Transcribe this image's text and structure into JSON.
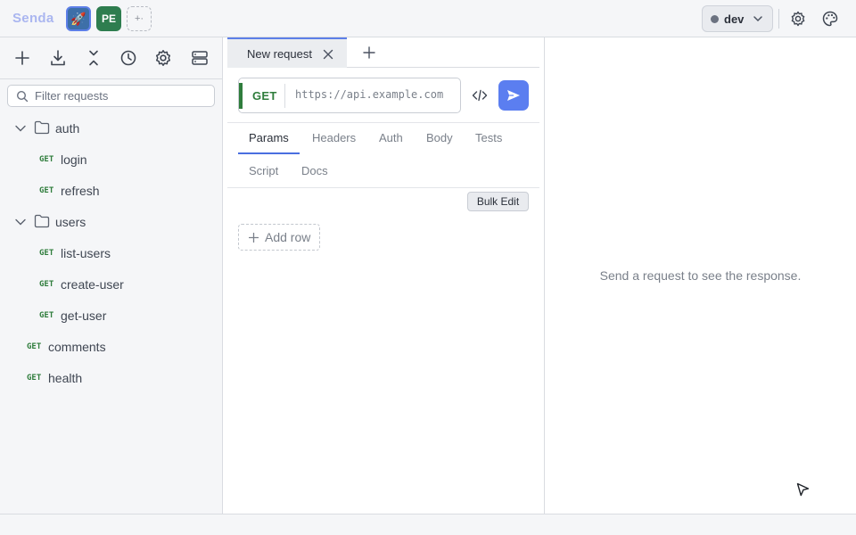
{
  "app": {
    "brand": "Senda"
  },
  "workspaces": [
    {
      "label": "🚀",
      "icon": "rocket-icon"
    },
    {
      "label": "PE"
    },
    {
      "label": "+·"
    }
  ],
  "environment": {
    "label": "dev"
  },
  "sidebar": {
    "filter_placeholder": "Filter requests",
    "tree": [
      {
        "type": "folder",
        "label": "auth",
        "expanded": true
      },
      {
        "type": "request",
        "method": "GET",
        "label": "login"
      },
      {
        "type": "request",
        "method": "GET",
        "label": "refresh"
      },
      {
        "type": "folder",
        "label": "users",
        "expanded": true
      },
      {
        "type": "request",
        "method": "GET",
        "label": "list-users"
      },
      {
        "type": "request",
        "method": "GET",
        "label": "create-user"
      },
      {
        "type": "request",
        "method": "GET",
        "label": "get-user"
      },
      {
        "type": "request",
        "method": "GET",
        "label": "comments"
      },
      {
        "type": "request",
        "method": "GET",
        "label": "health"
      }
    ]
  },
  "request": {
    "tab_label": "New request",
    "method": "GET",
    "url": "https://api.example.com",
    "subtabs": [
      "Params",
      "Headers",
      "Auth",
      "Body",
      "Tests",
      "Script",
      "Docs"
    ],
    "active_subtab": "Params",
    "bulk_edit_label": "Bulk Edit",
    "add_row_label": "Add row"
  },
  "response": {
    "empty_message": "Send a request to see the response."
  },
  "colors": {
    "accent": "#5b7ef0",
    "get_method": "#2f7d3c",
    "brand": "#aab6f0"
  }
}
